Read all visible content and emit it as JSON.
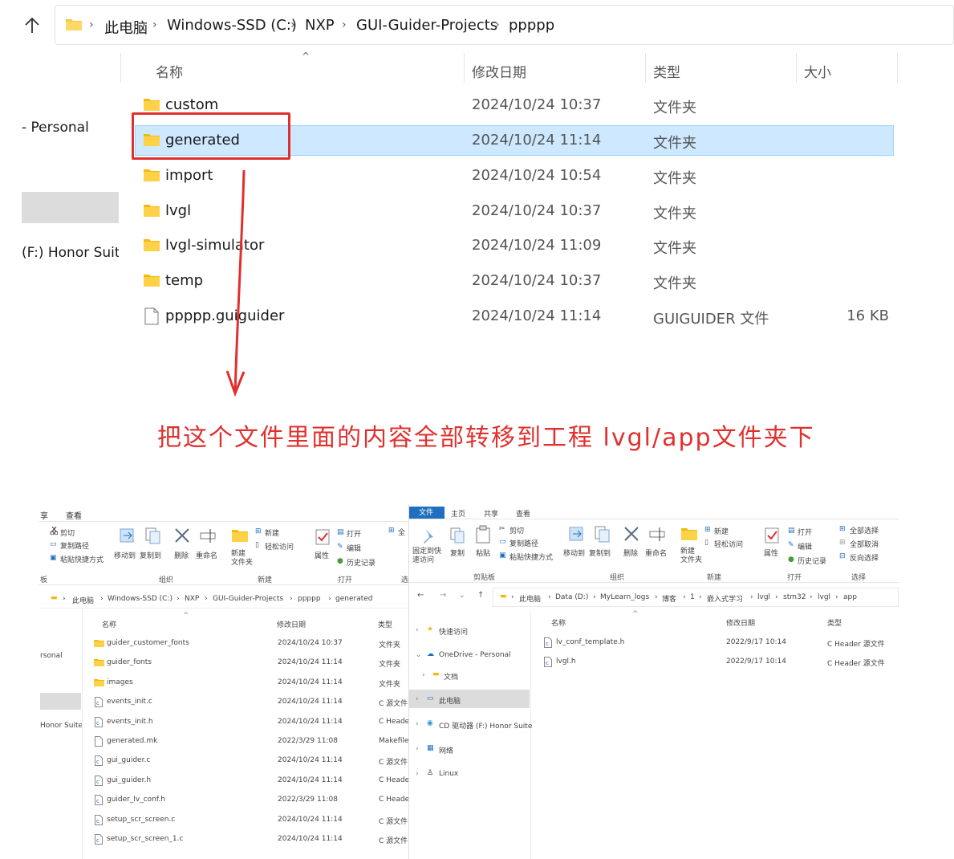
{
  "top": {
    "breadcrumb": [
      "此电脑",
      "Windows-SSD (C:)",
      "NXP",
      "GUI-Guider-Projects",
      "ppppp"
    ],
    "sidebar": [
      "- Personal",
      "(F:) Honor Suite"
    ],
    "columns": {
      "name": "名称",
      "date": "修改日期",
      "type": "类型",
      "size": "大小"
    },
    "files": [
      {
        "name": "custom",
        "date": "2024/10/24 10:37",
        "type": "文件夹",
        "size": "",
        "kind": "folder"
      },
      {
        "name": "generated",
        "date": "2024/10/24 11:14",
        "type": "文件夹",
        "size": "",
        "kind": "folder"
      },
      {
        "name": "import",
        "date": "2024/10/24 10:54",
        "type": "文件夹",
        "size": "",
        "kind": "folder"
      },
      {
        "name": "lvgl",
        "date": "2024/10/24 10:37",
        "type": "文件夹",
        "size": "",
        "kind": "folder"
      },
      {
        "name": "lvgl-simulator",
        "date": "2024/10/24 11:09",
        "type": "文件夹",
        "size": "",
        "kind": "folder"
      },
      {
        "name": "temp",
        "date": "2024/10/24 10:37",
        "type": "文件夹",
        "size": "",
        "kind": "folder"
      },
      {
        "name": "ppppp.guiguider",
        "date": "2024/10/24 11:14",
        "type": "GUIGUIDER 文件",
        "size": "16 KB",
        "kind": "file"
      }
    ]
  },
  "annotation": "把这个文件里面的内容全部转移到工程   lvgl/app文件夹下",
  "annotation_color": "#e0302e",
  "left_explorer": {
    "tabs": [
      "享",
      "查看"
    ],
    "ribbon": {
      "cut": "剪切",
      "copy_path": "复制路径",
      "paste_shortcut": "粘贴快捷方式",
      "move_to": "移动到",
      "copy_to": "复制到",
      "delete": "删除",
      "rename": "重命名",
      "new_item": "新建",
      "easy_access": "轻松访问",
      "new_folder": "新建\n文件夹",
      "properties": "属性",
      "open": "打开",
      "edit": "编辑",
      "history": "历史记录",
      "select_all_frag": "全",
      "group_clip": "板",
      "group_org": "组织",
      "group_new": "新建",
      "group_open": "打开",
      "group_sel": "选"
    },
    "breadcrumb": [
      "此电脑",
      "Windows-SSD (C:)",
      "NXP",
      "GUI-Guider-Projects",
      "ppppp",
      "generated"
    ],
    "sidebar": [
      "rsonal",
      "Honor Suite"
    ],
    "columns": {
      "name": "名称",
      "date": "修改日期",
      "type": "类型"
    },
    "files": [
      {
        "name": "guider_customer_fonts",
        "date": "2024/10/24 10:37",
        "type": "文件夹",
        "kind": "folder"
      },
      {
        "name": "guider_fonts",
        "date": "2024/10/24 11:14",
        "type": "文件夹",
        "kind": "folder"
      },
      {
        "name": "images",
        "date": "2024/10/24 11:14",
        "type": "文件夹",
        "kind": "folder"
      },
      {
        "name": "events_init.c",
        "date": "2024/10/24 11:14",
        "type": "C 源文件",
        "kind": "c"
      },
      {
        "name": "events_init.h",
        "date": "2024/10/24 11:14",
        "type": "C Heade",
        "kind": "c"
      },
      {
        "name": "generated.mk",
        "date": "2022/3/29 11:08",
        "type": "Makefile",
        "kind": "file"
      },
      {
        "name": "gui_guider.c",
        "date": "2024/10/24 11:14",
        "type": "C 源文件",
        "kind": "c"
      },
      {
        "name": "gui_guider.h",
        "date": "2024/10/24 11:14",
        "type": "C Heade",
        "kind": "c"
      },
      {
        "name": "guider_lv_conf.h",
        "date": "2022/3/29 11:08",
        "type": "C Heade",
        "kind": "c"
      },
      {
        "name": "setup_scr_screen.c",
        "date": "2024/10/24 11:14",
        "type": "C 源文件",
        "kind": "c"
      },
      {
        "name": "setup_scr_screen_1.c",
        "date": "2024/10/24 11:14",
        "type": "C 源文件",
        "kind": "c"
      }
    ]
  },
  "right_explorer": {
    "tabs": [
      "文件",
      "主页",
      "共享",
      "查看"
    ],
    "ribbon": {
      "pin": "固定到快\n速访问",
      "copy": "复制",
      "paste": "粘贴",
      "cut": "剪切",
      "copy_path": "复制路径",
      "paste_shortcut": "粘贴快捷方式",
      "move_to": "移动到",
      "copy_to": "复制到",
      "delete": "删除",
      "rename": "重命名",
      "new_item": "新建",
      "easy_access": "轻松访问",
      "new_folder": "新建\n文件夹",
      "properties": "属性",
      "open": "打开",
      "edit": "编辑",
      "history": "历史记录",
      "select_all": "全部选择",
      "select_none": "全部取消",
      "invert": "反向选择",
      "group_clip": "剪贴板",
      "group_org": "组织",
      "group_new": "新建",
      "group_open": "打开",
      "group_sel": "选择"
    },
    "breadcrumb": [
      "此电脑",
      "Data (D:)",
      "MyLearn_logs",
      "博客",
      "1",
      "嵌入式学习",
      "lvgl",
      "stm32",
      "lvgl",
      "app"
    ],
    "nav": [
      "快速访问",
      "OneDrive - Personal",
      "文档",
      "此电脑",
      "CD 驱动器 (F:) Honor Suite",
      "网络",
      "Linux"
    ],
    "columns": {
      "name": "名称",
      "date": "修改日期",
      "type": "类型"
    },
    "files": [
      {
        "name": "lv_conf_template.h",
        "date": "2022/9/17 10:14",
        "type": "C Header 源文件"
      },
      {
        "name": "lvgl.h",
        "date": "2022/9/17 10:14",
        "type": "C Header 源文件"
      }
    ]
  }
}
